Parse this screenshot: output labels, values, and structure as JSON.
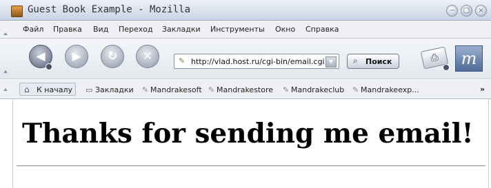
{
  "window": {
    "title": "Guest Book Example - Mozilla",
    "app_icon": "mozilla-app-icon",
    "controls": {
      "minimize": "−",
      "maximize": "□",
      "close": "×"
    }
  },
  "menubar": {
    "items": [
      "Файл",
      "Правка",
      "Вид",
      "Переход",
      "Закладки",
      "Инструменты",
      "Окно",
      "Справка"
    ]
  },
  "navbar": {
    "back_glyph": "◀",
    "forward_glyph": "▶",
    "reload_glyph": "↻",
    "stop_glyph": "✕",
    "url": "http://vlad.host.ru/cgi-bin/email.cgi",
    "url_icon_glyph": "✎",
    "url_dropdown_glyph": "▼",
    "search_label": "Поиск",
    "search_icon_glyph": "⌕",
    "print_glyph": "⎙",
    "logo_text": "m"
  },
  "bookmarks": {
    "home_label": "К началу",
    "home_icon_glyph": "⌂",
    "folder_label": "Закладки",
    "folder_icon_glyph": "▭",
    "links": [
      "Mandrakesoft",
      "Mandrakestore",
      "Mandrakeclub",
      "Mandrakeexp..."
    ],
    "link_icon_glyph": "✎",
    "more_label": "»"
  },
  "page": {
    "heading": "Thanks for sending me email!"
  },
  "colors": {
    "titlebar": "#c9d3e3",
    "toolbar": "#e3e7ed",
    "page_background": "#ffffff"
  }
}
